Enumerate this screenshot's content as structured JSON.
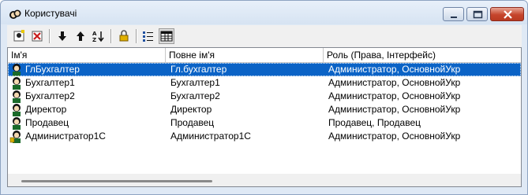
{
  "window": {
    "title": "Користувачі"
  },
  "toolbar": {
    "buttons": [
      {
        "icon": "new-user-icon",
        "tooltip": ""
      },
      {
        "icon": "delete-user-icon",
        "tooltip": ""
      },
      {
        "icon": "arrow-down-icon",
        "tooltip": ""
      },
      {
        "icon": "arrow-up-icon",
        "tooltip": ""
      },
      {
        "icon": "sort-az-icon",
        "tooltip": ""
      },
      {
        "icon": "lock-icon",
        "tooltip": ""
      },
      {
        "icon": "list-view-icon",
        "tooltip": ""
      },
      {
        "icon": "table-view-icon",
        "tooltip": ""
      }
    ]
  },
  "list": {
    "columns": [
      "Ім'я",
      "Повне ім'я",
      "Роль (Права, Інтерфейс)"
    ],
    "rows": [
      {
        "name": "ГлБухгалтер",
        "full_name": "Гл.бухгалтер",
        "role": "Администратор, ОсновнойУкр",
        "selected": true
      },
      {
        "name": "Бухгалтер1",
        "full_name": "Бухгалтер1",
        "role": "Администратор, ОсновнойУкр",
        "selected": false
      },
      {
        "name": "Бухгалтер2",
        "full_name": "Бухгалтер2",
        "role": "Администратор, ОсновнойУкр",
        "selected": false
      },
      {
        "name": "Директор",
        "full_name": "Директор",
        "role": "Администратор, ОсновнойУкр",
        "selected": false
      },
      {
        "name": "Продавец",
        "full_name": "Продавец",
        "role": "Продавец, Продавец",
        "selected": false
      },
      {
        "name": "Администратор1С",
        "full_name": "Администратор1С",
        "role": "Администратор, ОсновнойУкр",
        "selected": false
      }
    ]
  },
  "colors": {
    "selection": "#0b63c6",
    "window_frame": "#dfe9f5"
  }
}
